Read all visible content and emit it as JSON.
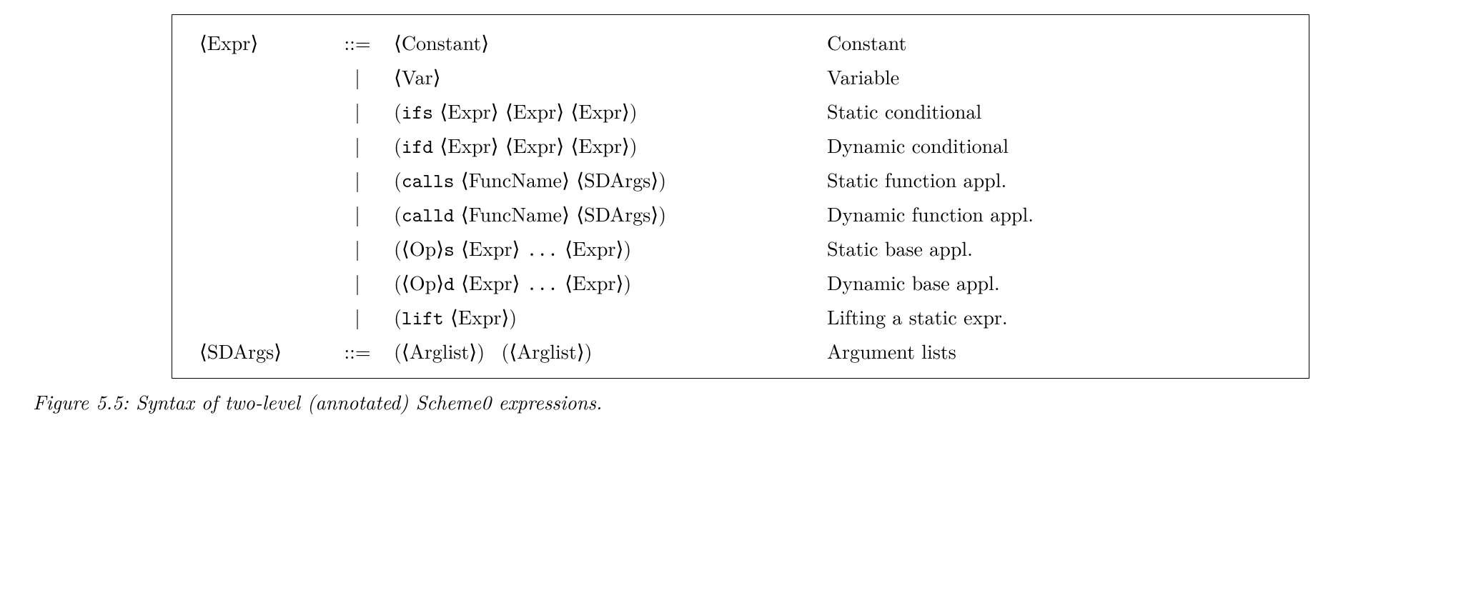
{
  "grammar": {
    "rules": [
      {
        "lhs": "Expr",
        "op": "::=",
        "rhs_html": "⟨Constant⟩",
        "desc": "Constant"
      },
      {
        "lhs": "",
        "op": "|",
        "rhs_html": "⟨Var⟩",
        "desc": "Variable"
      },
      {
        "lhs": "",
        "op": "|",
        "rhs_html": "(<tt>ifs</tt> ⟨Expr⟩ ⟨Expr⟩ ⟨Expr⟩)",
        "desc": "Static conditional"
      },
      {
        "lhs": "",
        "op": "|",
        "rhs_html": "(<tt>ifd</tt> ⟨Expr⟩ ⟨Expr⟩ ⟨Expr⟩)",
        "desc": "Dynamic conditional"
      },
      {
        "lhs": "",
        "op": "|",
        "rhs_html": "(<tt>calls</tt> ⟨FuncName⟩ ⟨SDArgs⟩)",
        "desc": "Static function appl."
      },
      {
        "lhs": "",
        "op": "|",
        "rhs_html": "(<tt>calld</tt> ⟨FuncName⟩ ⟨SDArgs⟩)",
        "desc": "Dynamic function appl."
      },
      {
        "lhs": "",
        "op": "|",
        "rhs_html": "(⟨Op⟩<tt>s</tt> ⟨Expr⟩ <tt>...</tt> ⟨Expr⟩)",
        "desc": "Static base appl."
      },
      {
        "lhs": "",
        "op": "|",
        "rhs_html": "(⟨Op⟩<tt>d</tt> ⟨Expr⟩ <tt>...</tt> ⟨Expr⟩)",
        "desc": "Dynamic base appl."
      },
      {
        "lhs": "",
        "op": "|",
        "rhs_html": "(<tt>lift</tt> ⟨Expr⟩)",
        "desc": "Lifting a static expr."
      },
      {
        "lhs": "SDArgs",
        "op": "::=",
        "rhs_html": "(⟨Arglist⟩)&nbsp; (⟨Arglist⟩)",
        "desc": "Argument lists"
      }
    ]
  },
  "caption": "Figure 5.5: Syntax of two-level (annotated) Scheme0 expressions."
}
